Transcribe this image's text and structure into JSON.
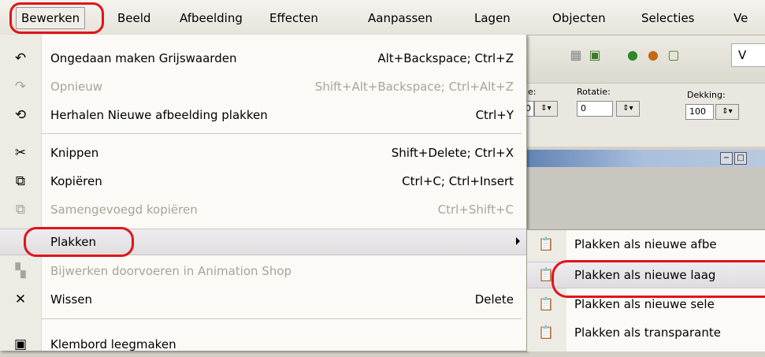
{
  "menubar": {
    "items": [
      {
        "label": "Bewerken",
        "active": true
      },
      {
        "label": "Beeld"
      },
      {
        "label": "Afbeelding"
      },
      {
        "label": "Effecten"
      },
      {
        "label": "Aanpassen"
      },
      {
        "label": "Lagen"
      },
      {
        "label": "Objecten"
      },
      {
        "label": "Selecties"
      },
      {
        "label": "Ve"
      }
    ]
  },
  "options": {
    "label1": "e:",
    "label2": "Rotatie:",
    "label3": "Dekking:",
    "value1": "0",
    "value2": "0",
    "value3": "100",
    "vbox": "V"
  },
  "menu": {
    "items": [
      {
        "label": "Ongedaan maken Grijswaarden",
        "shortcut": "Alt+Backspace; Ctrl+Z",
        "icon": "undo-icon",
        "disabled": false
      },
      {
        "label": "Opnieuw",
        "shortcut": "Shift+Alt+Backspace; Ctrl+Alt+Z",
        "icon": "redo-icon",
        "disabled": true
      },
      {
        "label": "Herhalen  Nieuwe afbeelding plakken",
        "shortcut": "Ctrl+Y",
        "icon": "repeat-icon",
        "disabled": false
      },
      {
        "label": "Knippen",
        "shortcut": "Shift+Delete; Ctrl+X",
        "icon": "scissors-icon",
        "disabled": false
      },
      {
        "label": "Kopiëren",
        "shortcut": "Ctrl+C; Ctrl+Insert",
        "icon": "copy-icon",
        "disabled": false
      },
      {
        "label": "Samengevoegd kopiëren",
        "shortcut": "Ctrl+Shift+C",
        "icon": "copy-merged-icon",
        "disabled": true
      },
      {
        "label": "Plakken",
        "shortcut": "",
        "icon": "",
        "disabled": false
      },
      {
        "label": "Bijwerken doorvoeren in Animation Shop",
        "shortcut": "",
        "icon": "animation-shop-icon",
        "disabled": true
      },
      {
        "label": "Wissen",
        "shortcut": "Delete",
        "icon": "delete-x-icon",
        "disabled": false
      },
      {
        "label": "Klembord leegmaken",
        "shortcut": "",
        "icon": "clipboard-clear-icon",
        "disabled": false
      }
    ]
  },
  "submenu": {
    "items": [
      {
        "label": "Plakken als nieuwe afbe",
        "icon": "paste-new-image-icon"
      },
      {
        "label": "Plakken als nieuwe laag",
        "icon": "paste-new-layer-icon"
      },
      {
        "label": "Plakken als nieuwe sele",
        "icon": "paste-new-selection-icon"
      },
      {
        "label": "Plakken als transparante",
        "icon": "paste-transparent-icon"
      }
    ]
  },
  "colors": {
    "highlight_circle": "#e0141a",
    "titlebar": "#5c7fb3"
  }
}
